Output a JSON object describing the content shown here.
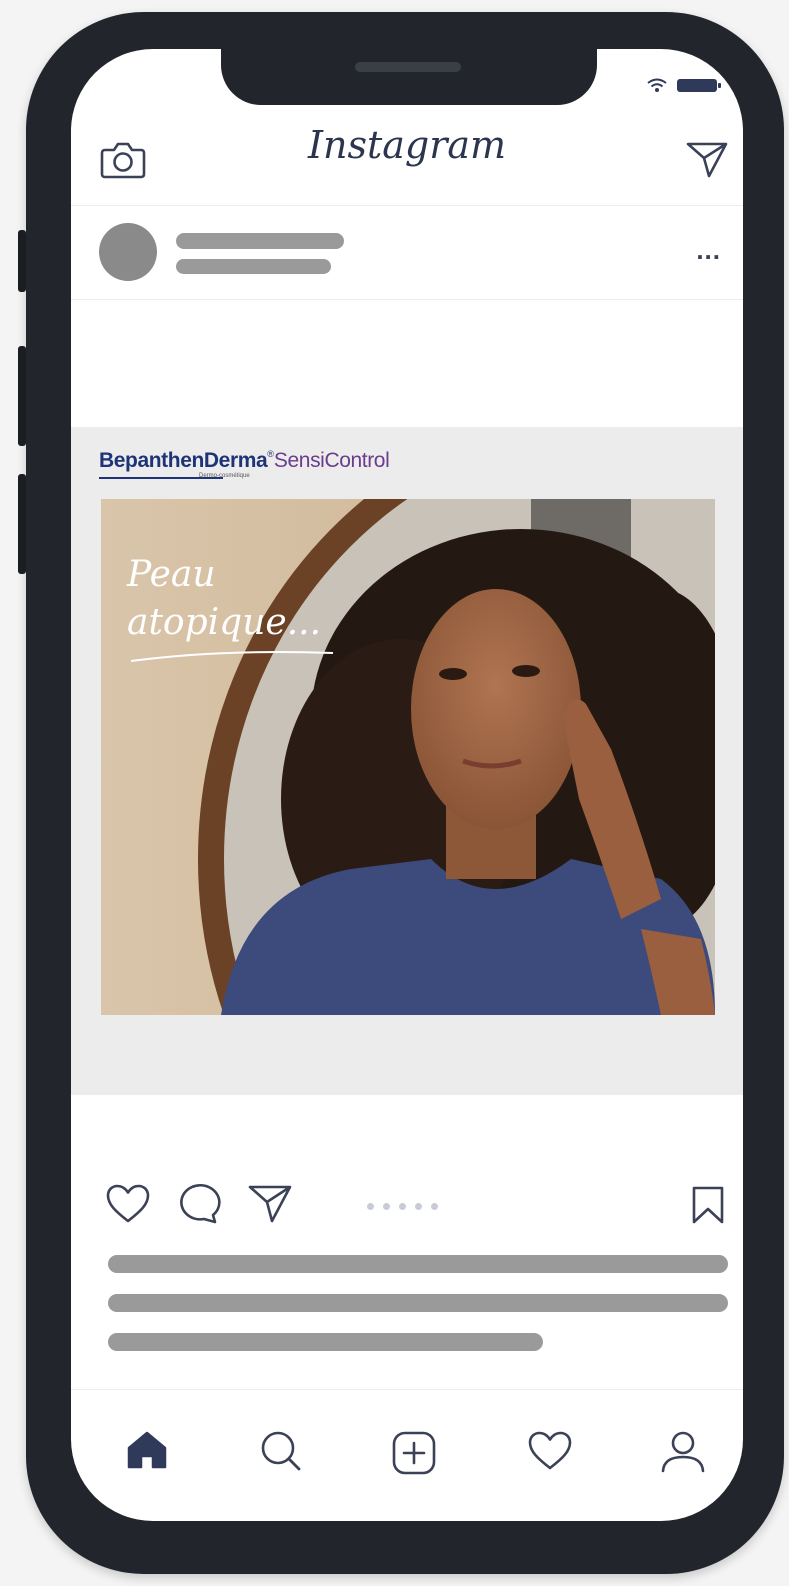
{
  "app": {
    "title": "Instagram"
  },
  "post": {
    "more_label": "...",
    "carousel_dots": 5
  },
  "ad": {
    "logo_brand": "BepanthenDerma",
    "logo_registered": "®",
    "logo_product": "SensiControl",
    "logo_tagline": "Dermo-cosmétique",
    "headline_line1": "Peau",
    "headline_line2": "atopique..."
  },
  "icons": {
    "camera": "camera-icon",
    "direct": "send-icon",
    "like": "heart-icon",
    "comment": "comment-icon",
    "share": "share-icon",
    "save": "bookmark-icon",
    "home": "home-icon",
    "search": "search-icon",
    "add": "add-post-icon",
    "activity": "heart-icon",
    "profile": "profile-icon"
  },
  "colors": {
    "icon_stroke": "#3b4156",
    "brand_blue": "#1f3478",
    "brand_purple": "#6b3d8c",
    "placeholder_gray": "#9a9a9a"
  }
}
